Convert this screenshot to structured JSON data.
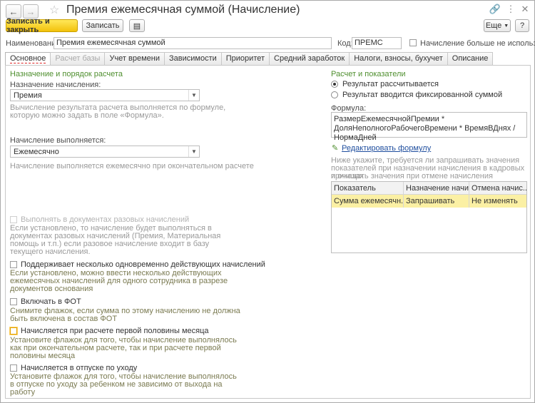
{
  "window": {
    "title": "Премия ежемесячная суммой (Начисление)",
    "back_icon": "arrow-left-icon",
    "forward_icon": "arrow-right-icon",
    "star_icon": "star-icon"
  },
  "toolbar": {
    "save_close_label": "Записать и закрыть",
    "save_label": "Записать",
    "more_label": "Еще",
    "help_label": "?"
  },
  "name_row": {
    "name_label": "Наименование:",
    "name_value": "Премия ежемесячная суммой",
    "code_label": "Код:",
    "code_value": "ПРЕМС",
    "not_used_label": "Начисление больше не используется"
  },
  "tabs": [
    {
      "label": "Основное"
    },
    {
      "label": "Расчет базы"
    },
    {
      "label": "Учет времени"
    },
    {
      "label": "Зависимости"
    },
    {
      "label": "Приоритет"
    },
    {
      "label": "Средний заработок"
    },
    {
      "label": "Налоги, взносы, бухучет"
    },
    {
      "label": "Описание"
    }
  ],
  "left": {
    "section_title": "Назначение и порядок расчета",
    "purpose_label": "Назначение начисления:",
    "purpose_value": "Премия",
    "purpose_hint_1": "Вычисление результата расчета выполняется по формуле,",
    "purpose_hint_2": "которую можно задать в поле «Формула».",
    "performed_label": "Начисление выполняется:",
    "performed_value": "Ежемесячно",
    "performed_hint": "Начисление выполняется ежемесячно при окончательном расчете",
    "one_time_label": "Выполнять в документах разовых начислений",
    "one_time_hint_1": "Если установлено, то начисление будет выполняться в",
    "one_time_hint_2": "документах разовых начислений (Премия, Материальная",
    "one_time_hint_3": "помощь и т.п.) если разовое начисление входит в базу",
    "one_time_hint_4": "текущего начисления.",
    "multi_label": "Поддерживает несколько одновременно действующих начислений",
    "multi_hint_1": "Если установлено, можно ввести несколько действующих",
    "multi_hint_2": "ежемесячных начислений для одного сотрудника в разрезе",
    "multi_hint_3": "документов основания",
    "fot_label": "Включать в ФОТ",
    "fot_hint_1": "Снимите флажок, если сумма по этому начислению не должна",
    "fot_hint_2": "быть включена в состав ФОТ",
    "first_half_label": "Начисляется при расчете первой половины месяца",
    "first_half_hint_1": "Установите флажок для того, чтобы начисление выполнялось",
    "first_half_hint_2": "как при окончательном расчете, так и при расчете первой",
    "first_half_hint_3": "половины месяца",
    "leave_label": "Начисляется в отпуске по уходу",
    "leave_hint_1": "Установите флажок для того, чтобы начисление выполнялось",
    "leave_hint_2": "в отпуске по уходу за ребенком не зависимо от выхода на",
    "leave_hint_3": "работу"
  },
  "right": {
    "section_title": "Расчет и показатели",
    "radio_calculated": "Результат рассчитывается",
    "radio_fixed": "Результат вводится фиксированной суммой",
    "formula_label": "Формула:",
    "formula_line_1": "РазмерЕжемесячнойПремии *",
    "formula_line_2": "ДоляНеполногоРабочегоВремени * ВремяВДнях / НормаДней",
    "edit_formula_link": "Редактировать формулу",
    "indicators_hint_1": "Ниже укажите, требуется ли запрашивать значения",
    "indicators_hint_2": "показателей при назначении начисления в кадровых приказах",
    "indicators_hint_3": "и очищать значения при отмене начисления",
    "grid_headers": [
      "Показатель",
      "Назначение начи...",
      "Отмена начис..."
    ],
    "grid_rows": [
      [
        "Сумма ежемесячн...",
        "Запрашивать",
        "Не изменять"
      ]
    ]
  }
}
